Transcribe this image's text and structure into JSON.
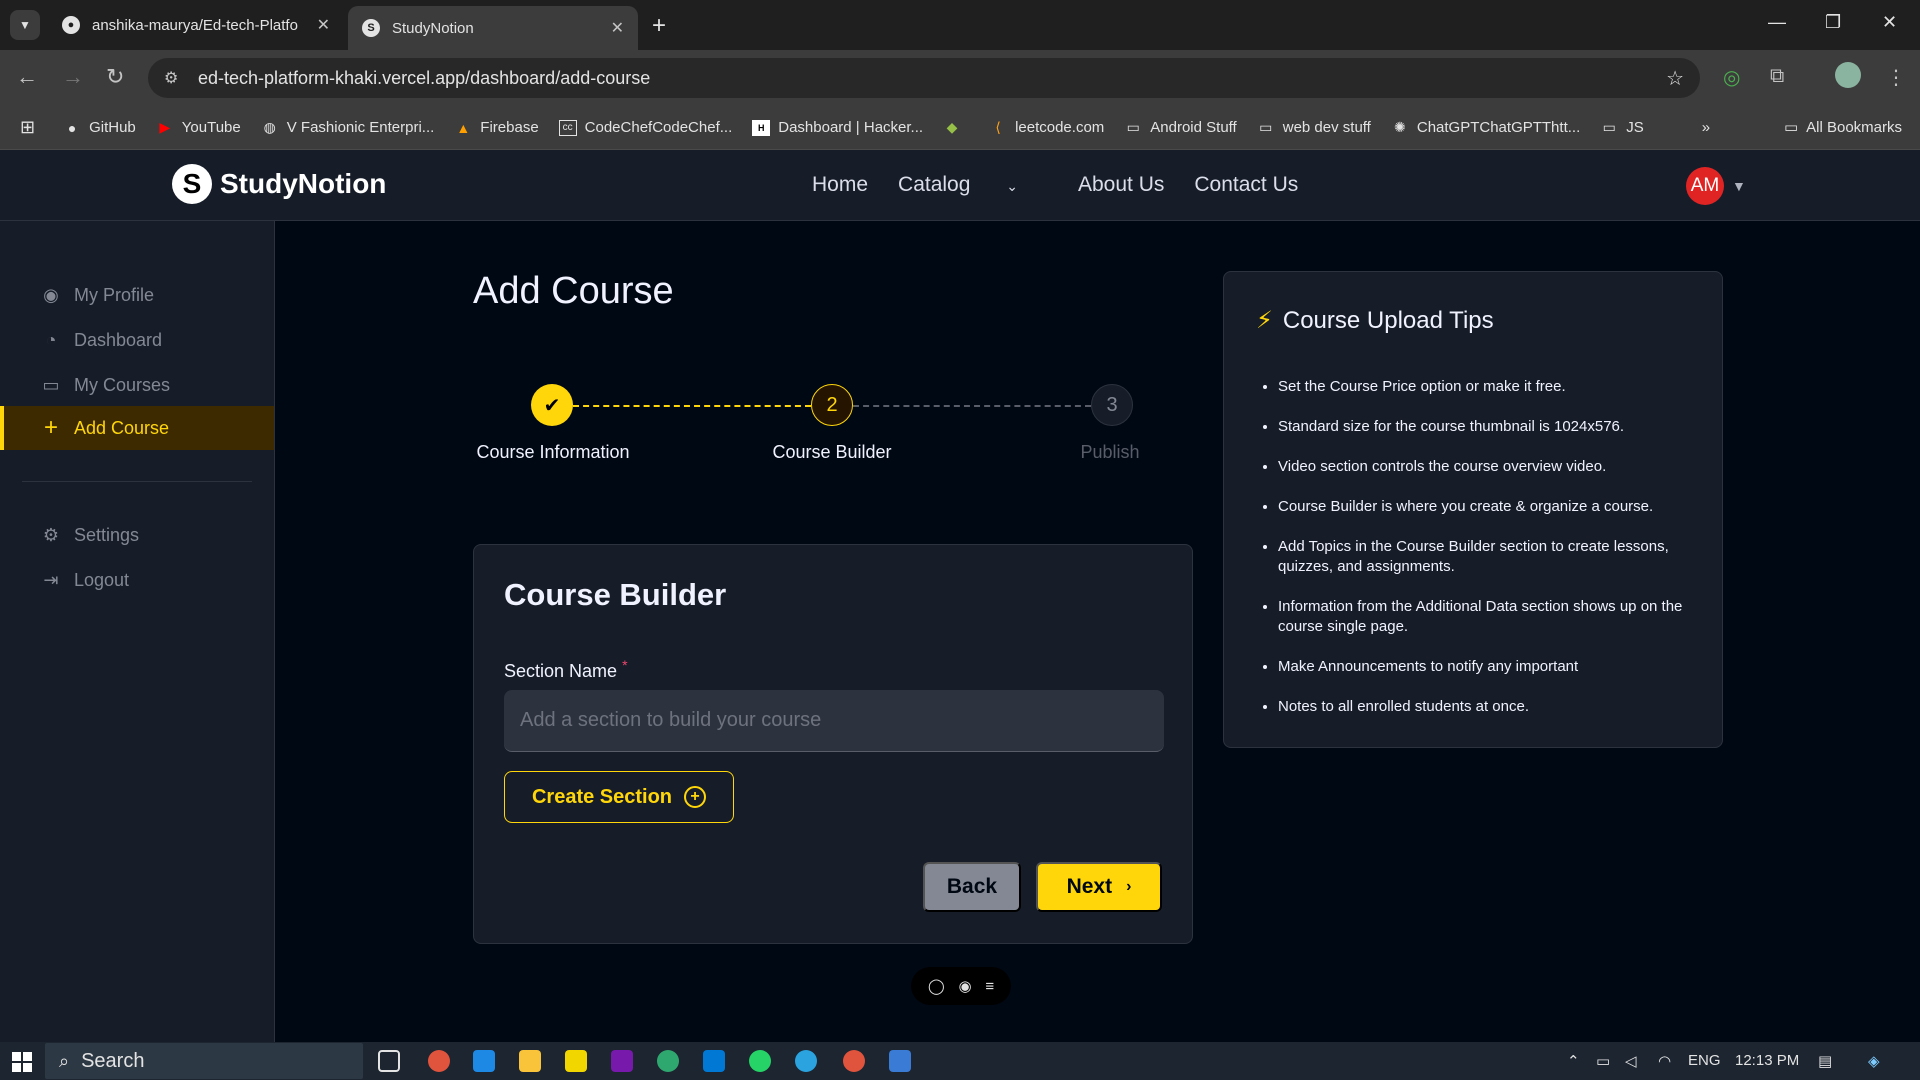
{
  "browser": {
    "tabs": [
      {
        "title": "anshika-maurya/Ed-tech-Platfo",
        "favicon": "github-icon"
      },
      {
        "title": "StudyNotion",
        "favicon": "studynotion-icon"
      }
    ],
    "url": "ed-tech-platform-khaki.vercel.app/dashboard/add-course",
    "bookmarks": [
      {
        "label": "GitHub",
        "icon": "github-icon"
      },
      {
        "label": "YouTube",
        "icon": "youtube-icon"
      },
      {
        "label": "V Fashionic Enterpri...",
        "icon": "globe-icon"
      },
      {
        "label": "Firebase",
        "icon": "firebase-icon"
      },
      {
        "label": "CodeChefCodeChef...",
        "icon": "codechef-icon"
      },
      {
        "label": "Dashboard | Hacker...",
        "icon": "hackerrank-icon"
      },
      {
        "label": "",
        "icon": "shopify-icon"
      },
      {
        "label": "leetcode.com",
        "icon": "leetcode-icon"
      },
      {
        "label": "Android Stuff",
        "icon": "folder-icon"
      },
      {
        "label": "web dev stuff",
        "icon": "folder-icon"
      },
      {
        "label": "ChatGPTChatGPTThtt...",
        "icon": "chatgpt-icon"
      },
      {
        "label": "JS",
        "icon": "folder-icon"
      }
    ],
    "all_bookmarks": "All Bookmarks"
  },
  "site": {
    "logo_text": "StudyNotion",
    "nav": {
      "home": "Home",
      "catalog": "Catalog",
      "about": "About Us",
      "contact": "Contact Us"
    },
    "avatar_initials": "AM"
  },
  "sidebar": {
    "items": [
      {
        "label": "My Profile",
        "icon": "user-circle-icon"
      },
      {
        "label": "Dashboard",
        "icon": "gauge-icon"
      },
      {
        "label": "My Courses",
        "icon": "monitor-icon"
      },
      {
        "label": "Add Course",
        "icon": "plus-icon"
      }
    ],
    "bottom_items": [
      {
        "label": "Settings",
        "icon": "gear-icon"
      },
      {
        "label": "Logout",
        "icon": "logout-icon"
      }
    ]
  },
  "main": {
    "title": "Add Course",
    "steps": [
      {
        "number": "1",
        "label": "Course Information",
        "status": "completed"
      },
      {
        "number": "2",
        "label": "Course Builder",
        "status": "current"
      },
      {
        "number": "3",
        "label": "Publish",
        "status": "upcoming"
      }
    ],
    "builder": {
      "title": "Course Builder",
      "section_label": "Section Name",
      "required_mark": "*",
      "section_placeholder": "Add a section to build your course",
      "create_label": "Create Section",
      "back_label": "Back",
      "next_label": "Next"
    }
  },
  "tips": {
    "title": "Course Upload Tips",
    "items": [
      "Set the Course Price option or make it free.",
      "Standard size for the course thumbnail is 1024x576.",
      "Video section controls the course overview video.",
      "Course Builder is where you create & organize a course.",
      "Add Topics in the Course Builder section to create lessons, quizzes, and assignments.",
      "Information from the Additional Data section shows up on the course single page.",
      "Make Announcements to notify any important",
      "Notes to all enrolled students at once."
    ]
  },
  "taskbar": {
    "search": "Search",
    "language": "ENG",
    "time": "12:13 PM"
  },
  "colors": {
    "accent": "#FFD60A",
    "background": "#000814",
    "panel": "#161D29"
  }
}
